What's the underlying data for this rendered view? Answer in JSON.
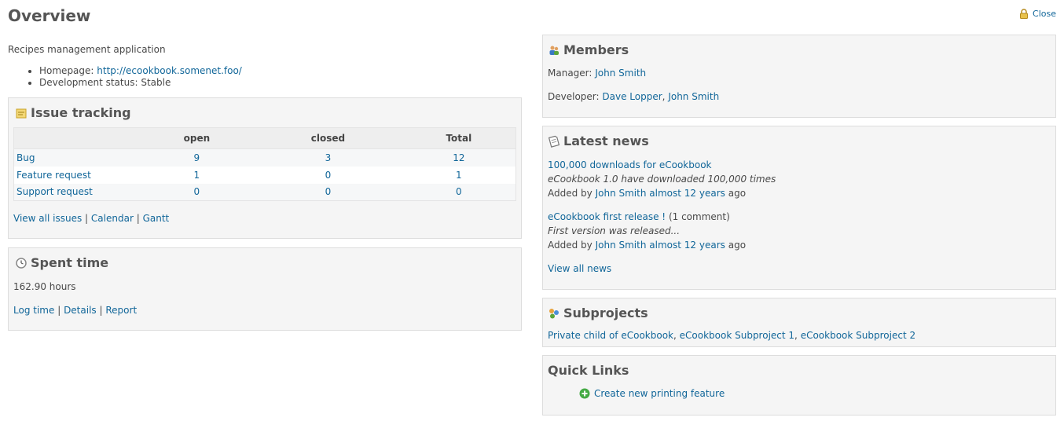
{
  "page": {
    "title": "Overview",
    "close_label": "Close"
  },
  "project": {
    "description": "Recipes management application",
    "homepage_label": "Homepage:",
    "homepage_url": "http://ecookbook.somenet.foo/",
    "status_label": "Development status:",
    "status_value": "Stable"
  },
  "issue_tracking": {
    "title": "Issue tracking",
    "columns": [
      "",
      "open",
      "closed",
      "Total"
    ],
    "rows": [
      {
        "tracker": "Bug",
        "open": "9",
        "closed": "3",
        "total": "12"
      },
      {
        "tracker": "Feature request",
        "open": "1",
        "closed": "0",
        "total": "1"
      },
      {
        "tracker": "Support request",
        "open": "0",
        "closed": "0",
        "total": "0"
      }
    ],
    "links": {
      "all": "View all issues",
      "calendar": "Calendar",
      "gantt": "Gantt",
      "sep": "|"
    }
  },
  "spent_time": {
    "title": "Spent time",
    "hours": "162.90 hours",
    "links": {
      "log": "Log time",
      "details": "Details",
      "report": "Report",
      "sep": "|"
    }
  },
  "members": {
    "title": "Members",
    "manager_label": "Manager:",
    "manager": "John Smith",
    "developer_label": "Developer:",
    "developers": [
      "Dave Lopper",
      "John Smith"
    ],
    "sep": ","
  },
  "news": {
    "title": "Latest news",
    "items": [
      {
        "title": "100,000 downloads for eCookbook",
        "comments": "",
        "summary": "eCookbook 1.0 have downloaded 100,000 times",
        "added_by": "Added by",
        "author": "John Smith",
        "age": "almost 12 years",
        "ago": "ago"
      },
      {
        "title": "eCookbook first release !",
        "comments": "(1 comment)",
        "summary": "First version was released...",
        "added_by": "Added by",
        "author": "John Smith",
        "age": "almost 12 years",
        "ago": "ago"
      }
    ],
    "view_all": "View all news"
  },
  "subprojects": {
    "title": "Subprojects",
    "items": [
      "Private child of eCookbook",
      "eCookbook Subproject 1",
      "eCookbook Subproject 2"
    ],
    "sep": ","
  },
  "quick_links": {
    "title": "Quick Links",
    "item": "Create new printing feature"
  },
  "colors": {
    "link": "#116699",
    "title": "#555555",
    "box_bg": "#f5f5f5",
    "box_border": "#dddddd",
    "add_icon": "#44aa44"
  }
}
